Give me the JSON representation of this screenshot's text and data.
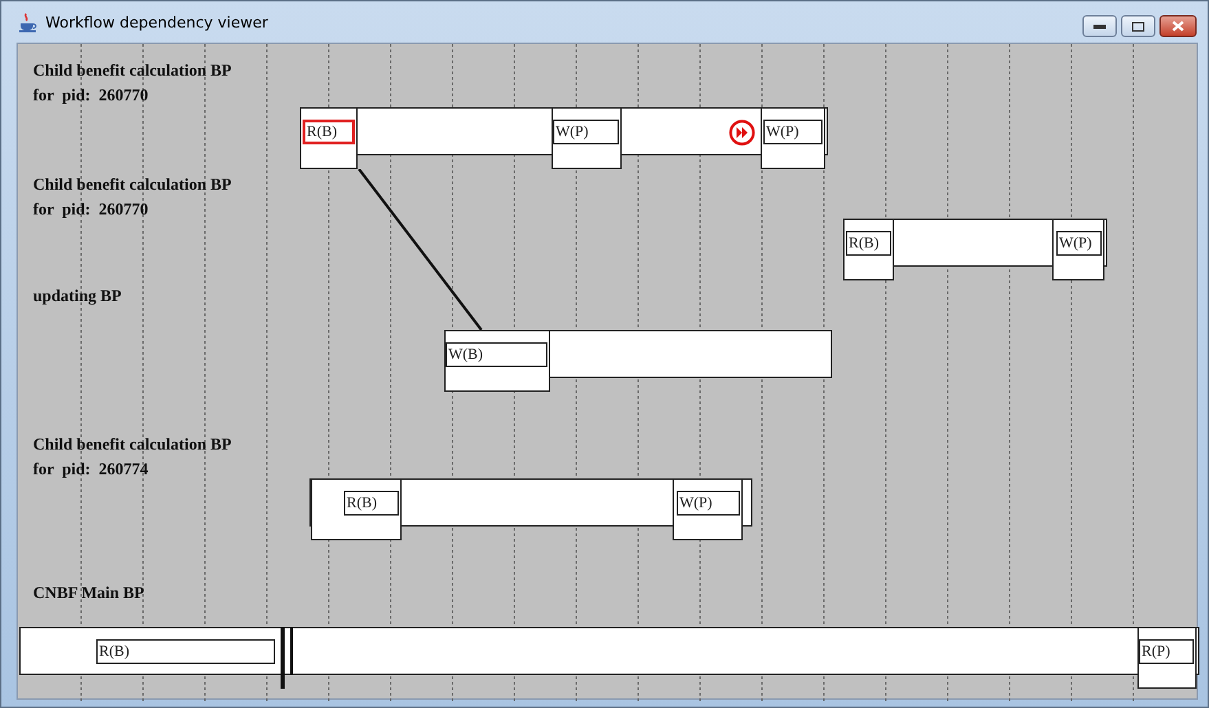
{
  "window": {
    "title": "Workflow dependency viewer"
  },
  "lanes": [
    {
      "title": "Child benefit calculation BP",
      "subtitle": "for  pid:  260770",
      "skip_marker": true,
      "blocks": [
        {
          "label": "R(B)",
          "selected": true
        },
        {
          "label": "W(P)",
          "selected": false
        },
        {
          "label": "W(P)",
          "selected": false
        }
      ]
    },
    {
      "title": "Child benefit calculation BP",
      "subtitle": "for  pid:  260770",
      "blocks": [
        {
          "label": "R(B)",
          "selected": false
        },
        {
          "label": "W(P)",
          "selected": false
        }
      ]
    },
    {
      "title": "updating BP",
      "blocks": [
        {
          "label": "W(B)",
          "selected": false
        }
      ]
    },
    {
      "title": "Child benefit calculation BP",
      "subtitle": "for  pid:  260774",
      "blocks": [
        {
          "label": "R(B)",
          "selected": false
        },
        {
          "label": "W(P)",
          "selected": false
        }
      ]
    },
    {
      "title": "CNBF Main BP",
      "blocks": [
        {
          "label": "R(B)",
          "selected": false
        },
        {
          "label": "R(P)",
          "selected": false
        }
      ]
    }
  ]
}
